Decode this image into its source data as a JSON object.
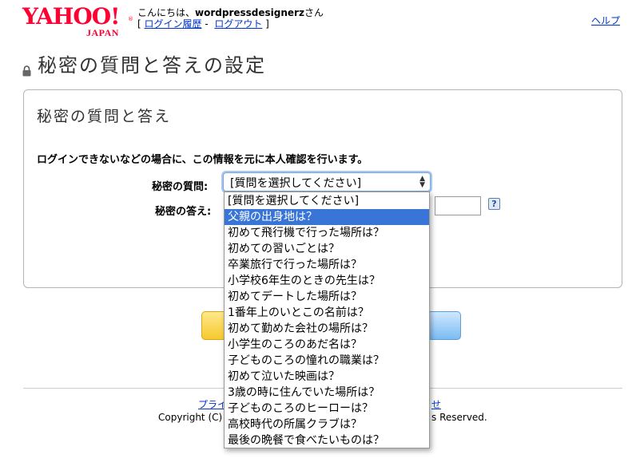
{
  "header": {
    "logo_text": "YAHOO!",
    "logo_sub": "JAPAN",
    "logo_reg": "®",
    "greeting_prefix": "こんにちは、",
    "username": "wordpressdesignerz",
    "greeting_suffix": "さん",
    "bracket_open": "[ ",
    "login_history": "ログイン履歴",
    "separator": " - ",
    "logout": "ログアウト",
    "bracket_close": " ]",
    "help": "ヘルプ"
  },
  "page_title": "秘密の質問と答えの設定",
  "panel": {
    "title": "秘密の質問と答え",
    "description": "ログインできないなどの場合に、この情報を元に本人確認を行います。",
    "question_label": "秘密の質問:",
    "answer_label": "秘密の答え:",
    "select_value": "[質問を選択してください]",
    "help_icon": "?"
  },
  "dropdown": {
    "selected_index": 1,
    "options": [
      "[質問を選択してください]",
      "父親の出身地は？",
      "初めて飛行機で行った場所は？",
      "初めての習いごとは？",
      "卒業旅行で行った場所は？",
      "小学校6年生のときの先生は？",
      "初めてデートした場所は？",
      "1番年上のいとこの名前は？",
      "初めて勤めた会社の場所は？",
      "小学生のころのあだ名は？",
      "子どものころの憧れの職業は？",
      "初めて泣いた映画は？",
      "3歳の時に住んでいた場所は？",
      "子どものころのヒーローは？",
      "高校時代の所属クラブは？",
      "最後の晩餐で食べたいものは？"
    ]
  },
  "footer": {
    "link_left": "プライ",
    "link_right": "せ",
    "copyright_left": "Copyright (C)",
    "copyright_right": "s Reserved."
  }
}
